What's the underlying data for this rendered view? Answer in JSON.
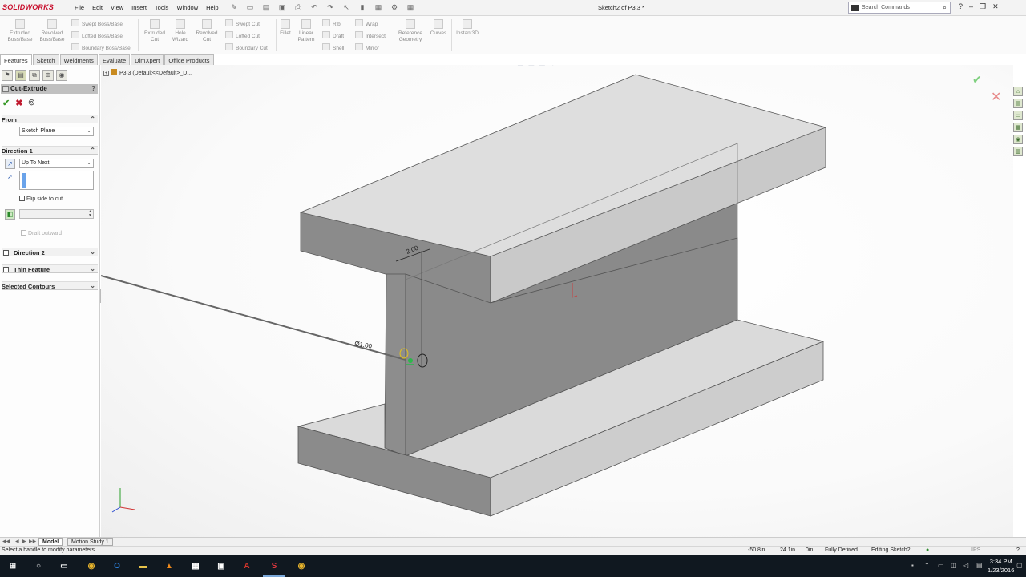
{
  "app": {
    "logo": "SOLIDWORKS",
    "menus": [
      "File",
      "Edit",
      "View",
      "Insert",
      "Tools",
      "Window",
      "Help"
    ],
    "document_title": "Sketch2 of P3.3 *",
    "search_placeholder": "Search Commands"
  },
  "ribbon": {
    "extruded_boss": "Extruded\nBoss/Base",
    "revolved_boss": "Revolved\nBoss/Base",
    "swept_boss": "Swept Boss/Base",
    "lofted_boss": "Lofted Boss/Base",
    "boundary_boss": "Boundary Boss/Base",
    "extruded_cut": "Extruded\nCut",
    "hole_wizard": "Hole\nWizard",
    "revolved_cut": "Revolved\nCut",
    "swept_cut": "Swept Cut",
    "lofted_cut": "Lofted Cut",
    "boundary_cut": "Boundary Cut",
    "fillet": "Fillet",
    "linear_pattern": "Linear\nPattern",
    "rib": "Rib",
    "draft": "Draft",
    "shell": "Shell",
    "wrap": "Wrap",
    "intersect": "Intersect",
    "mirror": "Mirror",
    "reference_geometry": "Reference\nGeometry",
    "curves": "Curves",
    "instant3d": "Instant3D"
  },
  "tabs": [
    {
      "label": "Features",
      "active": true
    },
    {
      "label": "Sketch",
      "active": false
    },
    {
      "label": "Weldments",
      "active": false
    },
    {
      "label": "Evaluate",
      "active": false
    },
    {
      "label": "DimXpert",
      "active": false
    },
    {
      "label": "Office Products",
      "active": false
    }
  ],
  "property_manager": {
    "title": "Cut-Extrude",
    "help": "?",
    "from_group": "From",
    "from_value": "Sketch Plane",
    "direction1_group": "Direction 1",
    "end_condition": "Up To Next",
    "flip_side": "Flip side to cut",
    "draft_outward": "Draft outward",
    "direction2_group": "Direction 2",
    "thin_feature_group": "Thin Feature",
    "selected_contours_group": "Selected Contours"
  },
  "tree": {
    "part_label": "P3.3  (Default<<Default>_D..."
  },
  "dimensions": {
    "width_dim": "2.00",
    "diameter_dim": "Ø1.00"
  },
  "bottom_tabs": [
    "Model",
    "Motion Study 1"
  ],
  "status_bar": {
    "message": "Select a handle to modify parameters",
    "x": "-50.8in",
    "y": "24.1in",
    "z": "0in",
    "state": "Fully Defined",
    "mode": "Editing Sketch2",
    "units": "IPS"
  },
  "taskbar": {
    "time": "3:34 PM",
    "date": "1/23/2016"
  }
}
